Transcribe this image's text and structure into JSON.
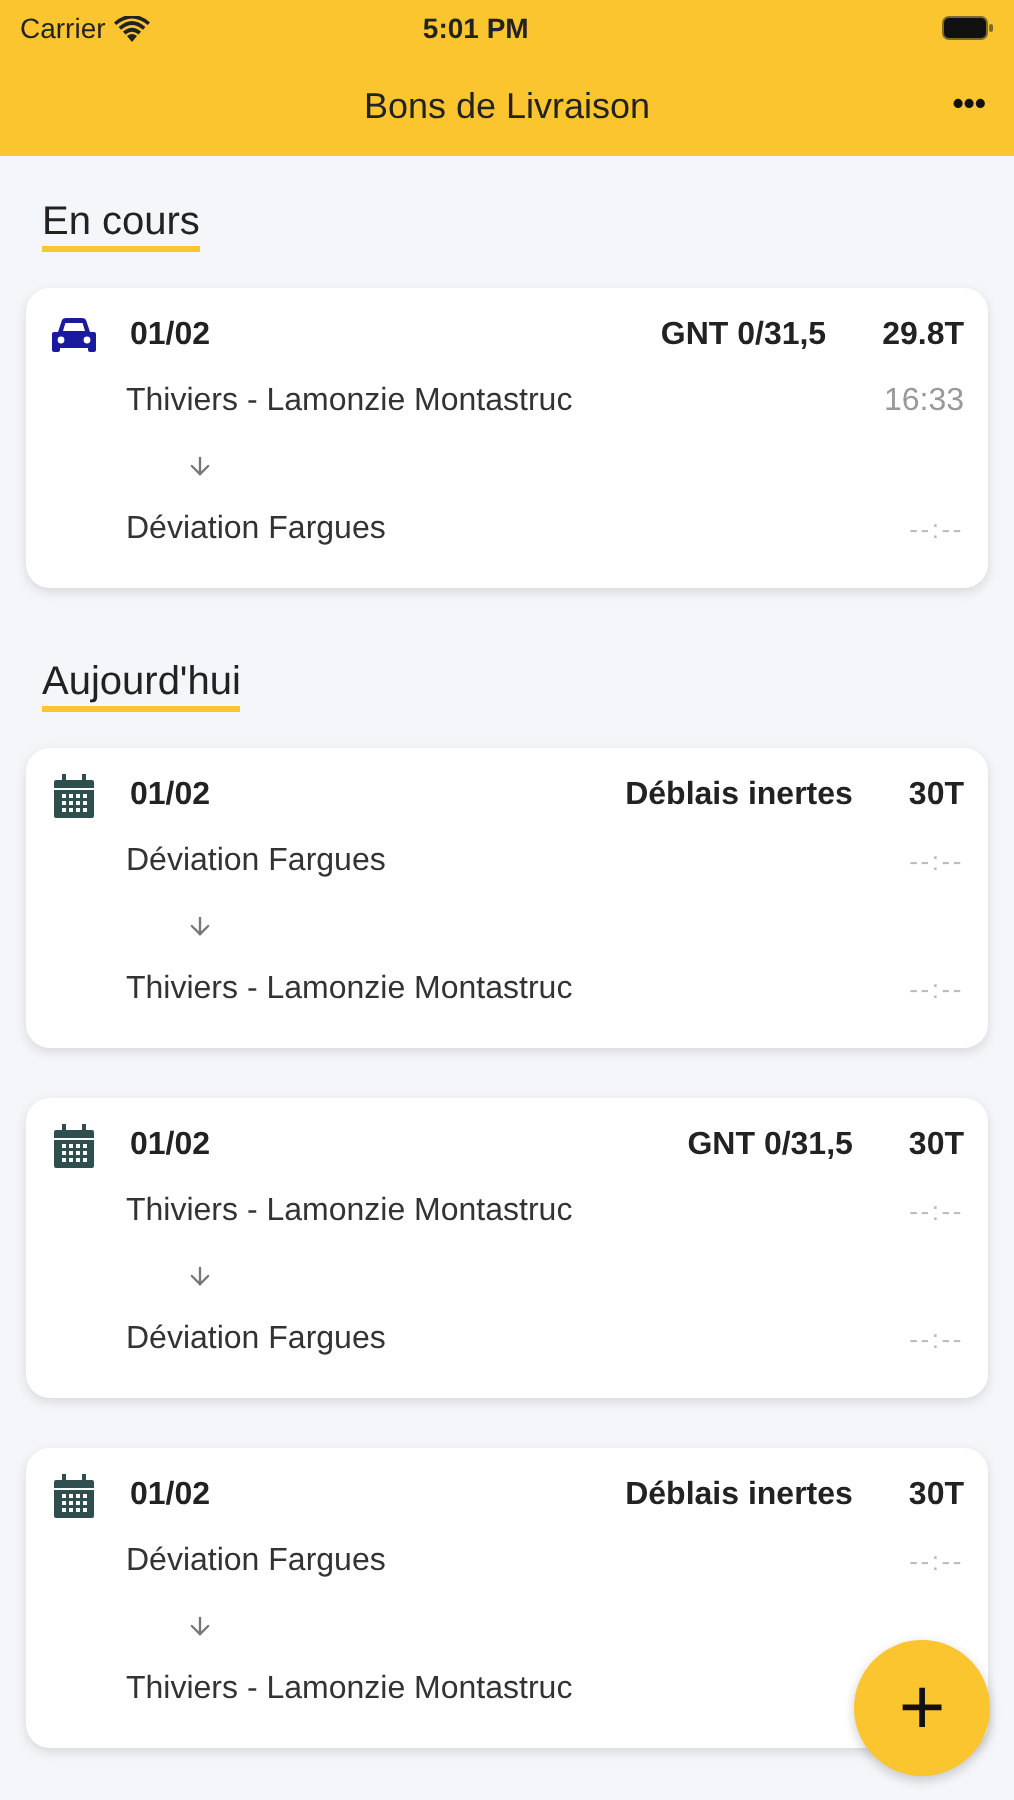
{
  "status_bar": {
    "carrier": "Carrier",
    "time": "5:01 PM"
  },
  "nav": {
    "title": "Bons de Livraison",
    "menu": "•••"
  },
  "sections": [
    {
      "title": "En cours",
      "cards": [
        {
          "kind": "car",
          "date": "01/02",
          "material": "GNT 0/31,5",
          "weight": "29.8T",
          "from": "Thiviers - Lamonzie Montastruc",
          "from_time": "16:33",
          "from_time_set": true,
          "to": "Déviation Fargues",
          "to_time": "--:--"
        }
      ]
    },
    {
      "title": "Aujourd'hui",
      "cards": [
        {
          "kind": "calendar",
          "date": "01/02",
          "material": "Déblais inertes",
          "weight": "30T",
          "from": "Déviation Fargues",
          "from_time": "--:--",
          "from_time_set": false,
          "to": "Thiviers - Lamonzie Montastruc",
          "to_time": "--:--"
        },
        {
          "kind": "calendar",
          "date": "01/02",
          "material": "GNT 0/31,5",
          "weight": "30T",
          "from": "Thiviers - Lamonzie Montastruc",
          "from_time": "--:--",
          "from_time_set": false,
          "to": "Déviation Fargues",
          "to_time": "--:--"
        },
        {
          "kind": "calendar",
          "date": "01/02",
          "material": "Déblais inertes",
          "weight": "30T",
          "from": "Déviation Fargues",
          "from_time": "--:--",
          "from_time_set": false,
          "to": "Thiviers - Lamonzie Montastruc"
        }
      ]
    }
  ],
  "fab": {
    "label": "+"
  }
}
